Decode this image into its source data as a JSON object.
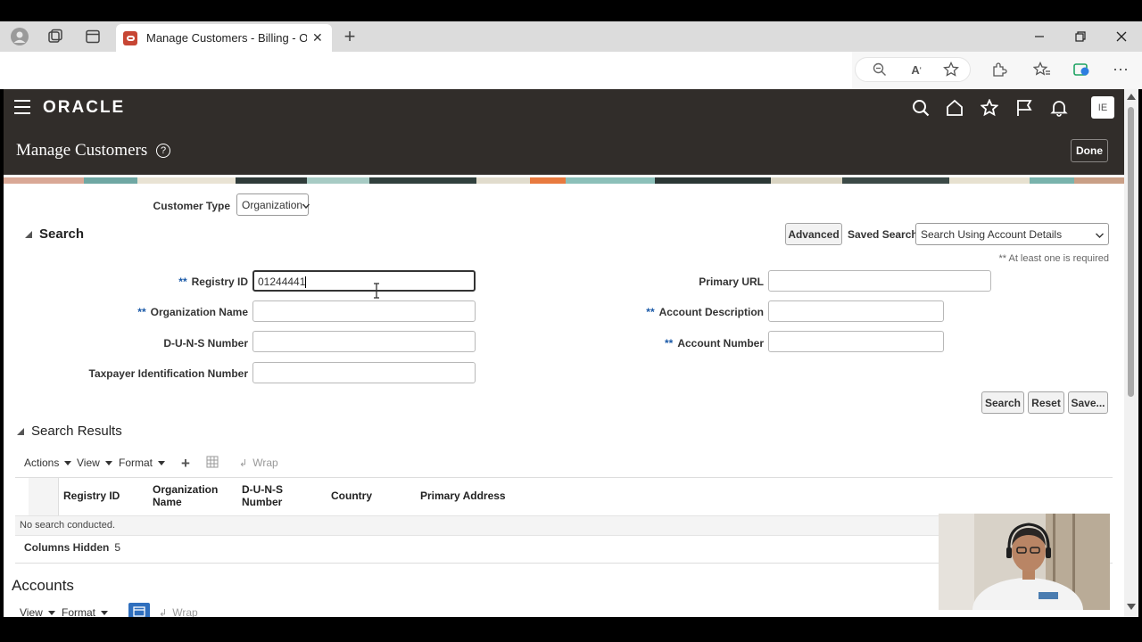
{
  "browser": {
    "tab_title": "Manage Customers - Billing - Ora",
    "tab_close": "✕",
    "new_tab": "+"
  },
  "oracle": {
    "logo": "ORACLE",
    "avatar": "IE",
    "page_title": "Manage Customers",
    "help": "?",
    "done_label": "Done"
  },
  "form": {
    "customer_type_label": "Customer Type",
    "customer_type_value": "Organization",
    "search_title": "Search",
    "advanced_label": "Advanced",
    "saved_search_label": "Saved Search",
    "saved_search_value": "Search Using Account Details",
    "required_note": "** At least one is required",
    "required_marker": "**",
    "registry_id_label": "Registry ID",
    "registry_id_value": "01244441",
    "org_name_label": "Organization Name",
    "duns_label": "D-U-N-S Number",
    "taxpayer_label": "Taxpayer Identification Number",
    "primary_url_label": "Primary URL",
    "account_desc_label": "Account Description",
    "account_number_label": "Account Number",
    "search_btn": "Search",
    "reset_btn": "Reset",
    "save_btn": "Save..."
  },
  "results": {
    "title": "Search Results",
    "actions": "Actions",
    "view": "View",
    "format": "Format",
    "wrap": "Wrap",
    "columns": [
      "Registry ID",
      "Organization Name",
      "D-U-N-S Number",
      "Country",
      "Primary Address"
    ],
    "empty_text": "No search conducted.",
    "columns_hidden_label": "Columns Hidden",
    "columns_hidden_count": "5"
  },
  "accounts": {
    "title": "Accounts",
    "view": "View",
    "format": "Format",
    "wrap": "Wrap"
  },
  "colors": {
    "header_bg": "#312d2a",
    "required_blue": "#1b5aa8",
    "oracle_red": "#c74634"
  }
}
